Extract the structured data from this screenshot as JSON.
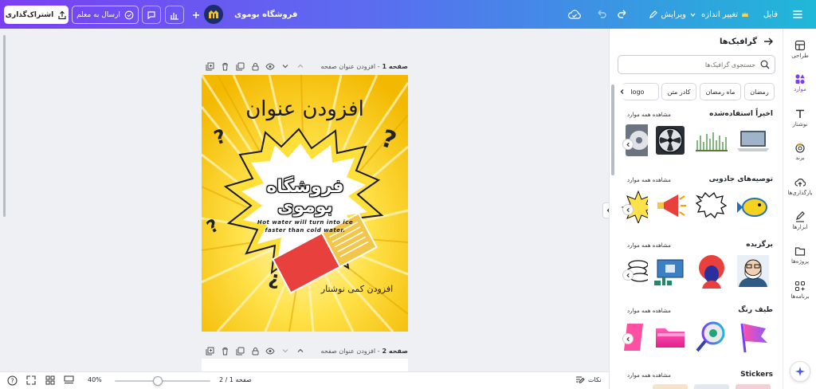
{
  "topbar": {
    "menu_icon": "hamburger-icon",
    "file_label": "فایل",
    "resize_label": "تغییر اندازه",
    "edit_label": "ویرایش",
    "shop_title": "فروشگاه بوموی",
    "send_teacher_label": "ارسال به معلم",
    "share_label": "اشتراک‌گذاری"
  },
  "page1": {
    "label": "صفحه 1",
    "title_placeholder": "- افزودن عنوان صفحه"
  },
  "page2": {
    "label": "صفحه 2",
    "title_placeholder": "- افزودن عنوان صفحه"
  },
  "design": {
    "heading": "افزودن عنوان",
    "brand": "فروشگاه بوموی",
    "body_text": "Hot water will turn into ice faster than cold water.",
    "sub_text": "افزودن کمی نوشتار",
    "q1": "?",
    "q2": "?",
    "q3": "?",
    "q4": "?"
  },
  "panel": {
    "title": "گرافیک‌ها",
    "search_placeholder": "جستجوی گرافیک‌ها",
    "chips": [
      "رمضان",
      "ماه رمضان",
      "کادر متن",
      "m logo"
    ],
    "see_all": "مشاهده همه موارد",
    "sections": [
      {
        "title": "اخیراً استفاده‌شده"
      },
      {
        "title": "توصیه‌های جادویی"
      },
      {
        "title": "برگزیده"
      },
      {
        "title": "طیف رنگ"
      },
      {
        "title": "Stickers"
      }
    ]
  },
  "rail": {
    "items": [
      {
        "label": "طراحی",
        "icon": "layout-icon"
      },
      {
        "label": "موارد",
        "icon": "elements-icon"
      },
      {
        "label": "نوشتار",
        "icon": "text-icon"
      },
      {
        "label": "برند",
        "icon": "brand-icon"
      },
      {
        "label": "بارگذاری‌ها",
        "icon": "upload-cloud-icon"
      },
      {
        "label": "ابزارها",
        "icon": "draw-icon"
      },
      {
        "label": "پروژه‌ها",
        "icon": "folder-icon"
      },
      {
        "label": "برنامه‌ها",
        "icon": "apps-icon"
      }
    ]
  },
  "bottom": {
    "notes_label": "نکات",
    "zoom": "40%",
    "page_indicator": "صفحه 1 / 2",
    "zoom_level": 0.45
  },
  "colors": {
    "accent": "#7b3ff2",
    "yellow": "#ffd21f",
    "red": "#e8403c",
    "canvas_bg": "#eef0f3"
  }
}
